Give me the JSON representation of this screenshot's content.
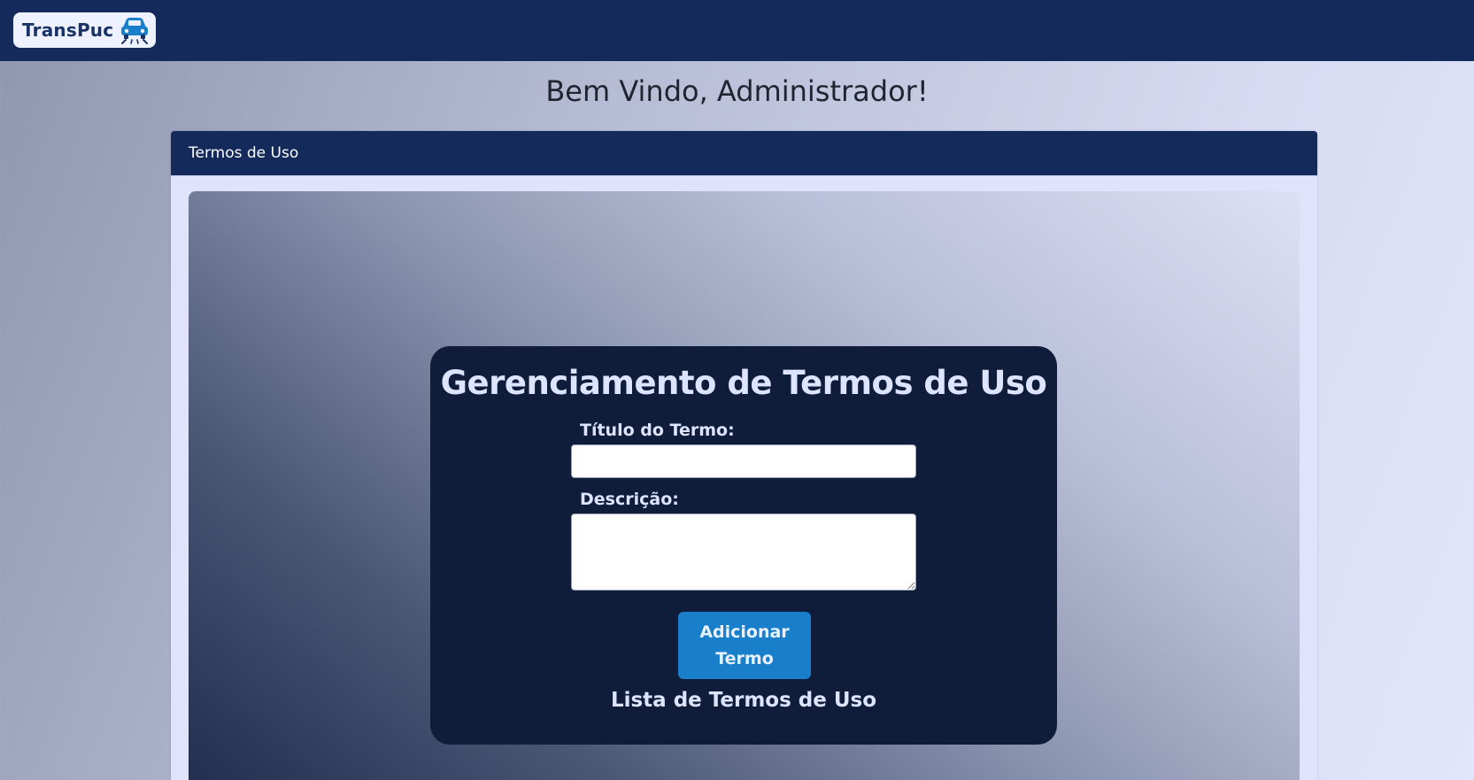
{
  "navbar": {
    "brand_text": "TransPuc",
    "brand_icon": "car-icon"
  },
  "page": {
    "welcome": "Bem Vindo, Administrador!"
  },
  "card": {
    "header_title": "Termos de Uso"
  },
  "form": {
    "title": "Gerenciamento de Termos de Uso",
    "title_label": "Título do Termo:",
    "title_value": "",
    "description_label": "Descrição:",
    "description_value": "",
    "submit_label": "Adicionar Termo",
    "list_title": "Lista de Termos de Uso"
  },
  "colors": {
    "navbar": "#142a5a",
    "panel": "#0f1d3a",
    "button": "#1a7fcb",
    "brand_text": "#1a3366"
  }
}
